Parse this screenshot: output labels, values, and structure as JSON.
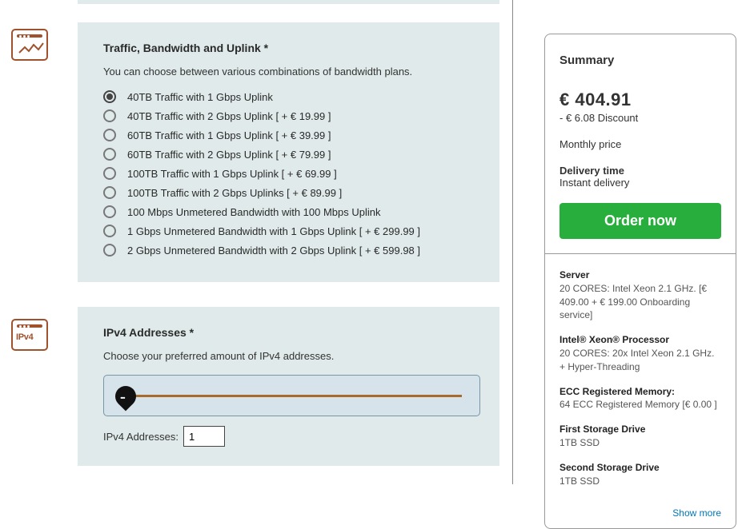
{
  "traffic": {
    "title": "Traffic, Bandwidth and Uplink *",
    "desc": "You can choose between various combinations of bandwidth plans.",
    "options": [
      {
        "label": "40TB Traffic with 1 Gbps Uplink",
        "selected": true
      },
      {
        "label": "40TB Traffic with 2 Gbps Uplink [ + € 19.99 ]",
        "selected": false
      },
      {
        "label": "60TB Traffic with 1 Gbps Uplink [ + € 39.99 ]",
        "selected": false
      },
      {
        "label": "60TB Traffic with 2 Gbps Uplink [ + € 79.99 ]",
        "selected": false
      },
      {
        "label": "100TB Traffic with 1 Gbps Uplink [ + € 69.99 ]",
        "selected": false
      },
      {
        "label": "100TB Traffic with 2 Gbps Uplinks [ + € 89.99 ]",
        "selected": false
      },
      {
        "label": "100 Mbps Unmetered Bandwidth with 100 Mbps Uplink",
        "selected": false
      },
      {
        "label": "1 Gbps Unmetered Bandwidth with 1 Gbps Uplink [ + € 299.99 ]",
        "selected": false
      },
      {
        "label": "2 Gbps Unmetered Bandwidth with 2 Gbps Uplink [ + € 599.98 ]",
        "selected": false
      }
    ]
  },
  "ipv4": {
    "title": "IPv4 Addresses *",
    "desc": "Choose your preferred amount of IPv4 addresses.",
    "input_label": "IPv4 Addresses:",
    "value": "1"
  },
  "summary": {
    "heading": "Summary",
    "price": "€ 404.91",
    "discount": "- € 6.08 Discount",
    "monthly": "Monthly price",
    "delivery_label": "Delivery time",
    "delivery_value": "Instant delivery",
    "order_label": "Order now",
    "items": [
      {
        "title": "Server",
        "detail": "20 CORES: Intel Xeon 2.1 GHz. [€ 409.00 + € 199.00 Onboarding service]"
      },
      {
        "title": "Intel® Xeon® Processor",
        "detail": "20 CORES: 20x Intel Xeon 2.1 GHz. + Hyper-Threading"
      },
      {
        "title": "ECC Registered Memory:",
        "detail": "64 ECC Registered Memory [€ 0.00 ]"
      },
      {
        "title": "First Storage Drive",
        "detail": "1TB SSD"
      },
      {
        "title": "Second Storage Drive",
        "detail": "1TB SSD"
      }
    ],
    "show_more": "Show more"
  }
}
